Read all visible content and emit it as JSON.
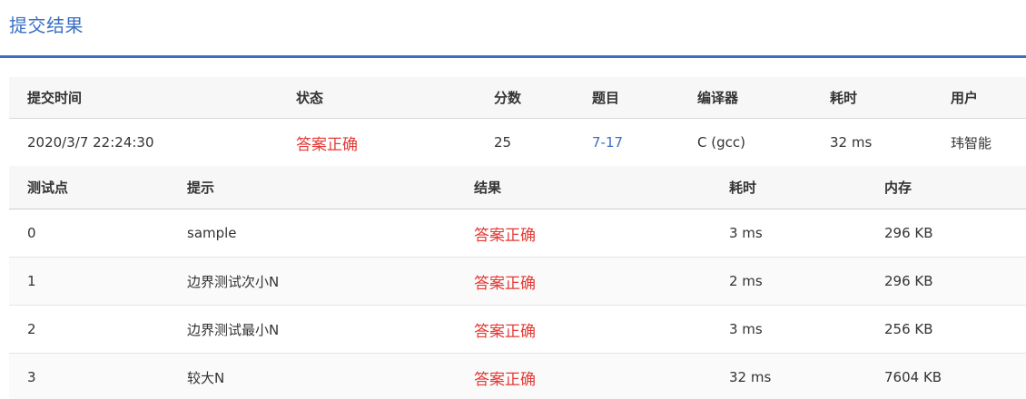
{
  "page": {
    "title": "提交结果"
  },
  "submission": {
    "headers": {
      "time": "提交时间",
      "status": "状态",
      "score": "分数",
      "problem": "题目",
      "compiler": "编译器",
      "elapsed": "耗时",
      "user": "用户"
    },
    "row": {
      "time": "2020/3/7 22:24:30",
      "status": "答案正确",
      "score": "25",
      "problem": "7-17",
      "compiler": "C (gcc)",
      "elapsed": "32 ms",
      "user": "玮智能"
    }
  },
  "testcases": {
    "headers": {
      "id": "测试点",
      "hint": "提示",
      "result": "结果",
      "time": "耗时",
      "memory": "内存"
    },
    "rows": [
      {
        "id": "0",
        "hint": "sample",
        "result": "答案正确",
        "time": "3 ms",
        "memory": "296 KB"
      },
      {
        "id": "1",
        "hint": "边界测试次小N",
        "result": "答案正确",
        "time": "2 ms",
        "memory": "296 KB"
      },
      {
        "id": "2",
        "hint": "边界测试最小N",
        "result": "答案正确",
        "time": "3 ms",
        "memory": "256 KB"
      },
      {
        "id": "3",
        "hint": "较大N",
        "result": "答案正确",
        "time": "32 ms",
        "memory": "7604 KB"
      }
    ]
  },
  "colors": {
    "accent": "#3a6fc4",
    "accepted": "#e53935",
    "header_bg": "#f7f7f7"
  }
}
